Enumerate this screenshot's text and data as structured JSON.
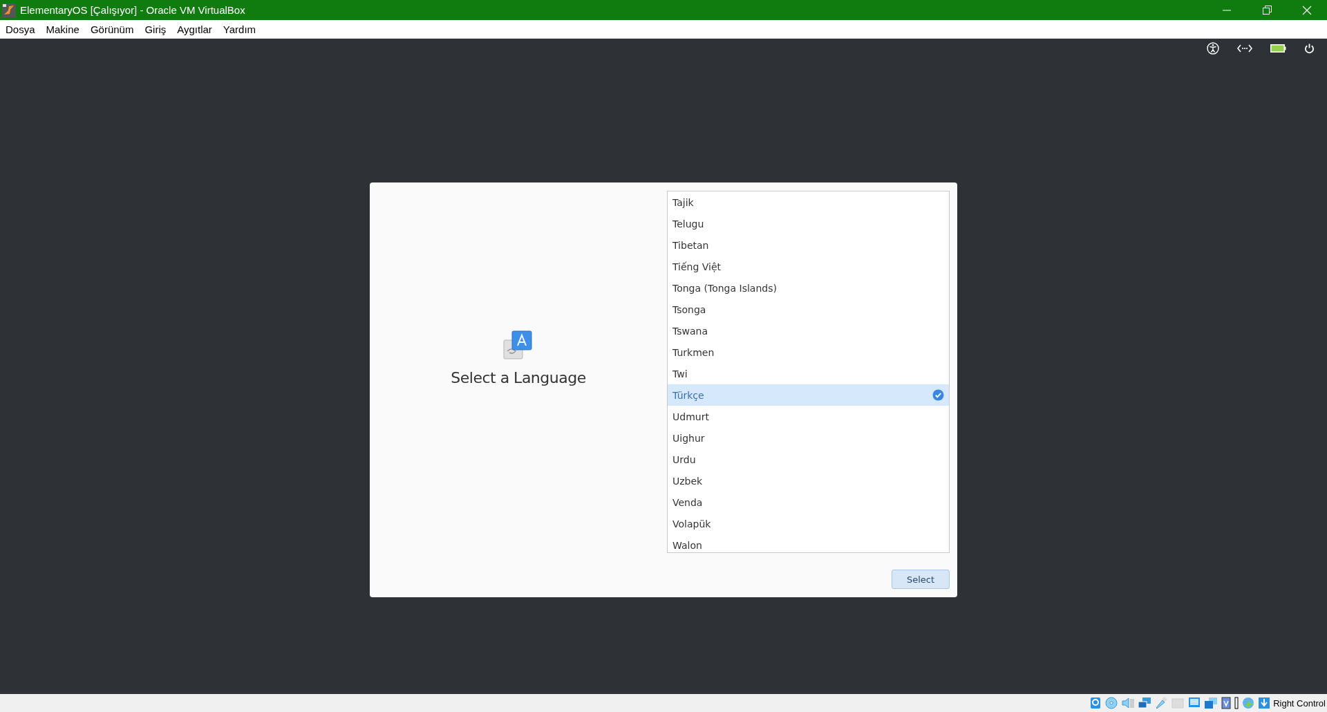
{
  "window": {
    "title": "ElementaryOS [Çalışıyor] - Oracle VM VirtualBox"
  },
  "menu": [
    "Dosya",
    "Makine",
    "Görünüm",
    "Giriş",
    "Aygıtlar",
    "Yardım"
  ],
  "dialog": {
    "heading": "Select a Language",
    "languages": [
      {
        "label": "Tajik",
        "selected": false
      },
      {
        "label": "Telugu",
        "selected": false
      },
      {
        "label": "Tibetan",
        "selected": false
      },
      {
        "label": "Tiếng Việt",
        "selected": false
      },
      {
        "label": "Tonga (Tonga Islands)",
        "selected": false
      },
      {
        "label": "Tsonga",
        "selected": false
      },
      {
        "label": "Tswana",
        "selected": false
      },
      {
        "label": "Turkmen",
        "selected": false
      },
      {
        "label": "Twi",
        "selected": false
      },
      {
        "label": "Türkçe",
        "selected": true
      },
      {
        "label": "Udmurt",
        "selected": false
      },
      {
        "label": "Uighur",
        "selected": false
      },
      {
        "label": "Urdu",
        "selected": false
      },
      {
        "label": "Uzbek",
        "selected": false
      },
      {
        "label": "Venda",
        "selected": false
      },
      {
        "label": "Volapük",
        "selected": false
      },
      {
        "label": "Walon",
        "selected": false
      }
    ],
    "button": "Select"
  },
  "status_bar": {
    "host_key": "Right Control"
  }
}
